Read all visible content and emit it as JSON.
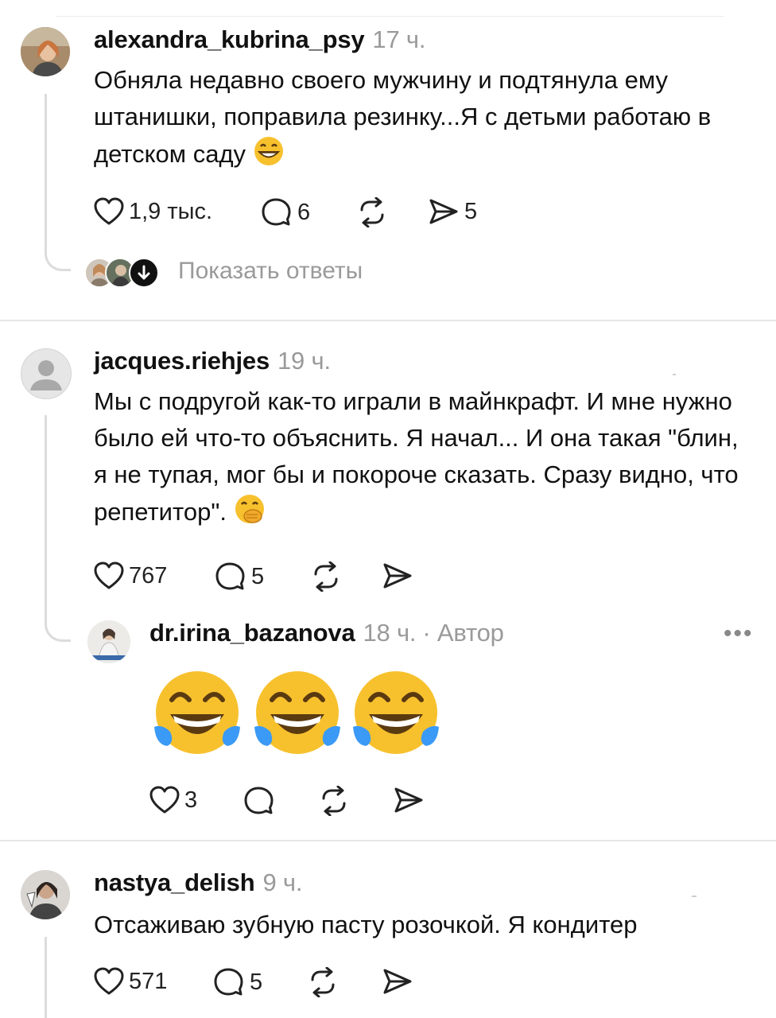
{
  "comments": [
    {
      "username": "alexandra_kubrina_psy",
      "time": "17 ч.",
      "text": "Обняла недавно своего мужчину и подтянула ему штанишки, поправила резинку...Я с детьми работаю в детском саду",
      "text_emoji": "grinning-face-emoji",
      "likes": "1,9 тыс.",
      "replies_count": "6",
      "shares": "5",
      "show_replies": "Показать ответы"
    },
    {
      "username": "jacques.riehjes",
      "time": "19 ч.",
      "text": "Мы с подругой как-то играли в майнкрафт. И мне нужно было ей что-то объяснить. Я начал... И она такая \"блин, я не тупая, мог бы и покороче сказать. Сразу видно, что репетитор\".",
      "text_emoji": "face-with-hand-over-mouth-emoji",
      "likes": "767",
      "replies_count": "5",
      "reply": {
        "username": "dr.irina_bazanova",
        "time": "18 ч.",
        "author_badge": "· Автор",
        "emojis": [
          "tears-of-joy-emoji",
          "tears-of-joy-emoji",
          "tears-of-joy-emoji"
        ],
        "likes": "3",
        "more": "•••"
      }
    },
    {
      "username": "nastya_delish",
      "time": "9 ч.",
      "text": "Отсаживаю зубную пасту розочкой. Я кондитер",
      "likes": "571",
      "replies_count": "5"
    }
  ],
  "colors": {
    "text": "#111111",
    "muted": "#9a9a9a",
    "divider": "#e6e6e6",
    "emoji_yellow": "#f7c12e",
    "emoji_tear": "#3b9af5"
  }
}
